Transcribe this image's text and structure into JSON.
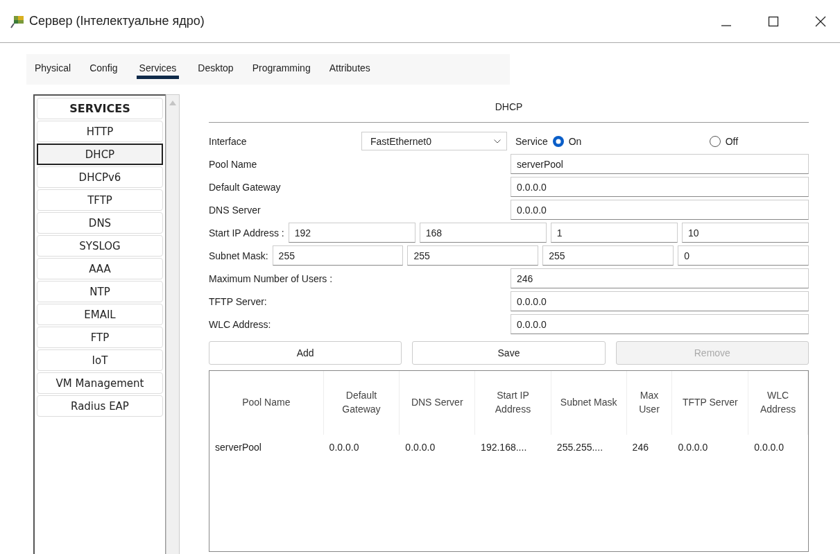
{
  "window": {
    "title": "Сервер (Інтелектуальне ядро)"
  },
  "tabs": [
    {
      "label": "Physical",
      "selected": false
    },
    {
      "label": "Config",
      "selected": false
    },
    {
      "label": "Services",
      "selected": true
    },
    {
      "label": "Desktop",
      "selected": false
    },
    {
      "label": "Programming",
      "selected": false
    },
    {
      "label": "Attributes",
      "selected": false
    }
  ],
  "services": {
    "heading": "SERVICES",
    "items": [
      {
        "label": "HTTP",
        "selected": false
      },
      {
        "label": "DHCP",
        "selected": true
      },
      {
        "label": "DHCPv6",
        "selected": false
      },
      {
        "label": "TFTP",
        "selected": false
      },
      {
        "label": "DNS",
        "selected": false
      },
      {
        "label": "SYSLOG",
        "selected": false
      },
      {
        "label": "AAA",
        "selected": false
      },
      {
        "label": "NTP",
        "selected": false
      },
      {
        "label": "EMAIL",
        "selected": false
      },
      {
        "label": "FTP",
        "selected": false
      },
      {
        "label": "IoT",
        "selected": false
      },
      {
        "label": "VM Management",
        "selected": false
      },
      {
        "label": "Radius EAP",
        "selected": false
      }
    ]
  },
  "dhcp": {
    "title": "DHCP",
    "interface": {
      "label": "Interface",
      "value": "FastEthernet0"
    },
    "service": {
      "label": "Service",
      "options": [
        {
          "label": "On",
          "selected": true
        },
        {
          "label": "Off",
          "selected": false
        }
      ]
    },
    "fields": [
      {
        "kind": "single",
        "label": "Pool Name",
        "value": "serverPool"
      },
      {
        "kind": "single",
        "label": "Default Gateway",
        "value": "0.0.0.0"
      },
      {
        "kind": "single",
        "label": "DNS Server",
        "value": "0.0.0.0"
      },
      {
        "kind": "octets",
        "label": "Start IP Address :",
        "values": [
          "192",
          "168",
          "1",
          "10"
        ]
      },
      {
        "kind": "octets",
        "label": "Subnet Mask:",
        "values": [
          "255",
          "255",
          "255",
          "0"
        ]
      },
      {
        "kind": "single",
        "label": "Maximum Number of Users :",
        "value": "246"
      },
      {
        "kind": "single",
        "label": "TFTP Server:",
        "value": "0.0.0.0"
      },
      {
        "kind": "single",
        "label": "WLC Address:",
        "value": "0.0.0.0"
      }
    ],
    "buttons": [
      {
        "label": "Add",
        "disabled": false
      },
      {
        "label": "Save",
        "disabled": false
      },
      {
        "label": "Remove",
        "disabled": true
      }
    ],
    "table": {
      "columns": [
        "Pool Name",
        "Default Gateway",
        "DNS Server",
        "Start IP Address",
        "Subnet Mask",
        "Max User",
        "TFTP Server",
        "WLC Address"
      ],
      "rows": [
        [
          "serverPool",
          "0.0.0.0",
          "0.0.0.0",
          "192.168....",
          "255.255....",
          "246",
          "0.0.0.0",
          "0.0.0.0"
        ]
      ]
    }
  }
}
